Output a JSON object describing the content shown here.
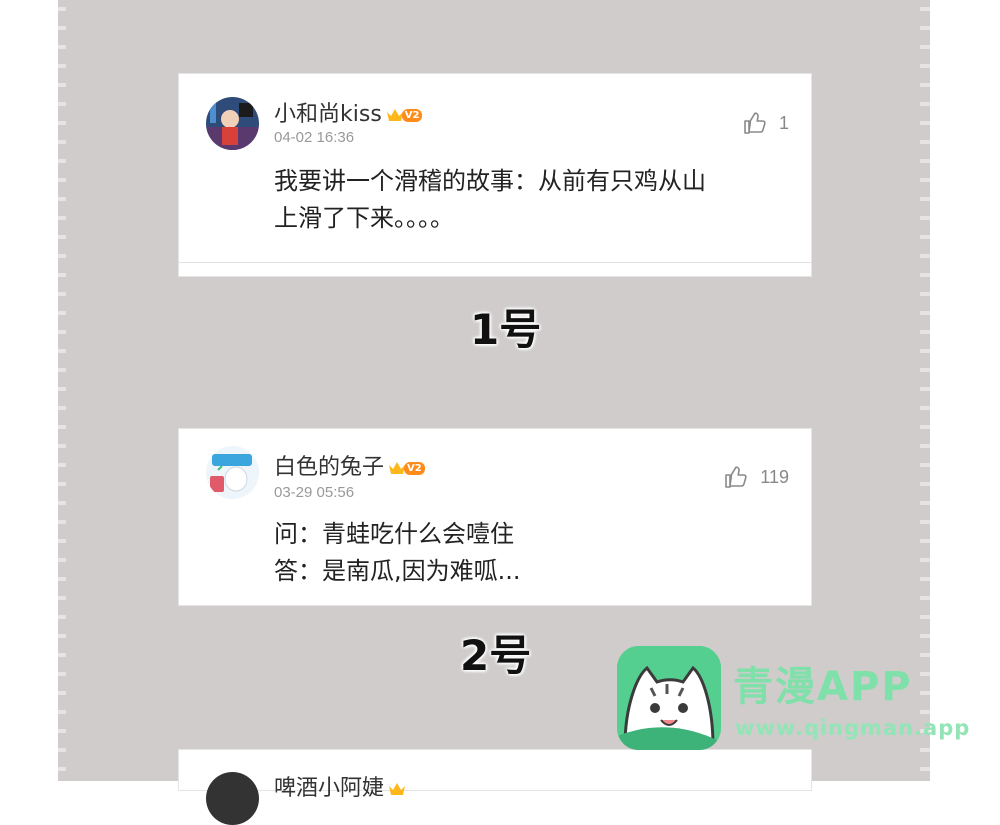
{
  "comments": [
    {
      "username": "小和尚kiss",
      "level": "V2",
      "timestamp": "04-02 16:36",
      "likes": "1",
      "lines": [
        "我要讲一个滑稽的故事：从前有只鸡从山",
        "上滑了下来。。。。"
      ],
      "label": "1号"
    },
    {
      "username": "白色的兔子",
      "level": "V2",
      "timestamp": "03-29 05:56",
      "likes": "119",
      "lines": [
        "问：青蛙吃什么会噎住",
        "答：是南瓜,因为难呱..."
      ],
      "label": "2号"
    },
    {
      "username": "啤酒小阿婕"
    }
  ],
  "watermark": {
    "title": "青漫APP",
    "url": "www.qingman.app"
  },
  "colors": {
    "panel": "#cfcccb",
    "vip_badge": "#ff8c1a",
    "watermark_green": "#55cf8f"
  }
}
